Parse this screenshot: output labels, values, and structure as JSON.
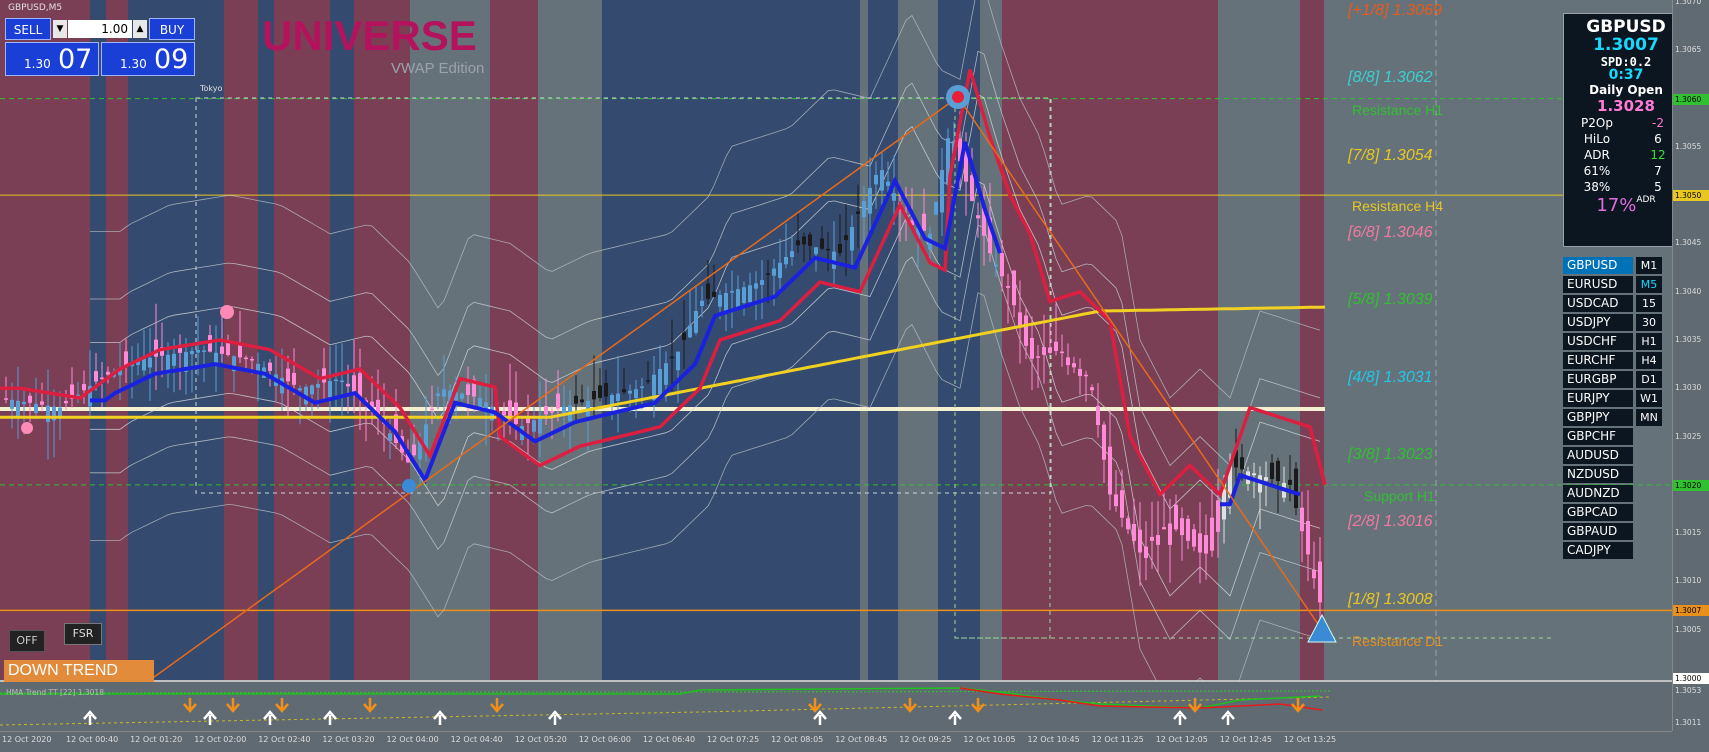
{
  "window": {
    "symbol_label": "GBPUSD,M5"
  },
  "trade_panel": {
    "sell_label": "SELL",
    "buy_label": "BUY",
    "lot_value": "1.00",
    "sell_price_prefix": "1.30",
    "sell_price_big": "07",
    "buy_price_prefix": "1.30",
    "buy_price_big": "09",
    "down_arrow": "▼",
    "up_arrow": "▲"
  },
  "branding": {
    "title": "UNIVERSE",
    "subtitle": "VWAP Edition",
    "session_label": "Tokyo"
  },
  "murrey_levels": [
    {
      "label": "[+1/8]  1.3069",
      "color": "#e85a1a",
      "price": 1.3069
    },
    {
      "label": "[8/8]  1.3062",
      "color": "#3ad0d0",
      "price": 1.3062
    },
    {
      "label": "[7/8]  1.3054",
      "color": "#e8c820",
      "price": 1.3054
    },
    {
      "label": "[6/8]  1.3046",
      "color": "#f07aa0",
      "price": 1.3046
    },
    {
      "label": "[5/8]  1.3039",
      "color": "#30c030",
      "price": 1.3039
    },
    {
      "label": "[4/8]  1.3031",
      "color": "#20c8e8",
      "price": 1.3031
    },
    {
      "label": "[3/8]  1.3023",
      "color": "#30c030",
      "price": 1.3023
    },
    {
      "label": "[2/8]  1.3016",
      "color": "#f07aa0",
      "price": 1.3016
    },
    {
      "label": "[1/8]  1.3008",
      "color": "#e8c820",
      "price": 1.3008
    }
  ],
  "sr_levels": [
    {
      "label": "Resistance H1",
      "color": "#30c030",
      "price": 1.306
    },
    {
      "label": "Resistance H4",
      "color": "#e8c820",
      "price": 1.305
    },
    {
      "label": "Support H1",
      "color": "#30c030",
      "price": 1.302
    },
    {
      "label": "Resistance D1",
      "color": "#e8901a",
      "price": 1.3005
    }
  ],
  "info_panel": {
    "symbol": "GBPUSD",
    "price": "1.3007",
    "spread": "SPD:0.2",
    "timer": "0:37",
    "daily_open_label": "Daily Open",
    "daily_open_value": "1.3028",
    "rows": [
      {
        "k": "P2Op",
        "v": "-2",
        "color": "#ff7ad5"
      },
      {
        "k": "HiLo",
        "v": "6",
        "color": "#ffffff"
      },
      {
        "k": "ADR",
        "v": "12",
        "color": "#30e030"
      },
      {
        "k": "61%",
        "v": "7",
        "color": "#ffffff"
      },
      {
        "k": "38%",
        "v": "5",
        "color": "#ffffff"
      }
    ],
    "adr_pct": "17%",
    "adr_label": "ADR"
  },
  "symbols": [
    "GBPUSD",
    "EURUSD",
    "USDCAD",
    "USDJPY",
    "USDCHF",
    "EURCHF",
    "EURGBP",
    "EURJPY",
    "GBPJPY",
    "GBPCHF",
    "AUDUSD",
    "NZDUSD",
    "AUDNZD",
    "GBPCAD",
    "GBPAUD",
    "CADJPY"
  ],
  "timeframes": [
    "M1",
    "M5",
    "15",
    "30",
    "H1",
    "H4",
    "D1",
    "W1",
    "MN"
  ],
  "buttons": {
    "off": "OFF",
    "fsr": "FSR"
  },
  "trend_label": "DOWN TREND",
  "hma_label": "HMA Trend TT [22] 1.3018",
  "price_axis": {
    "ticks": [
      "1.3070",
      "1.3065",
      "1.3060",
      "1.3055",
      "1.3050",
      "1.3045",
      "1.3040",
      "1.3035",
      "1.3030",
      "1.3025",
      "1.3020",
      "1.3015",
      "1.3010",
      "1.3005",
      "1.3000"
    ],
    "tags": [
      {
        "v": "1.3060",
        "color": "#30c030",
        "price": 1.306
      },
      {
        "v": "1.3050",
        "color": "#e8c820",
        "price": 1.305
      },
      {
        "v": "1.3020",
        "color": "#30c030",
        "price": 1.302
      },
      {
        "v": "1.3007",
        "color": "#e8901a",
        "price": 1.3007
      },
      {
        "v": "1.3000",
        "color": "#ffffff",
        "price": 1.3
      }
    ],
    "sub_ticks": [
      "1.3053",
      "1.3011"
    ]
  },
  "time_axis": [
    "12 Oct 2020",
    "12 Oct 00:40",
    "12 Oct 01:20",
    "12 Oct 02:00",
    "12 Oct 02:40",
    "12 Oct 03:20",
    "12 Oct 04:00",
    "12 Oct 04:40",
    "12 Oct 05:20",
    "12 Oct 06:00",
    "12 Oct 06:40",
    "12 Oct 07:25",
    "12 Oct 08:05",
    "12 Oct 08:45",
    "12 Oct 09:25",
    "12 Oct 10:05",
    "12 Oct 10:45",
    "12 Oct 11:25",
    "12 Oct 12:05",
    "12 Oct 12:45",
    "12 Oct 13:25"
  ],
  "colors": {
    "session_red": "#7a3f55",
    "session_blue": "#344a6e",
    "session_gray": "#66727a",
    "vwap_blue": "#1a22e0",
    "ema_red": "#dc1f40",
    "ma_yellow": "#f0d020"
  }
}
